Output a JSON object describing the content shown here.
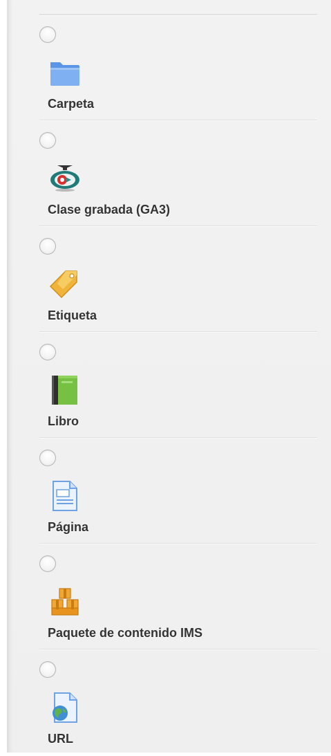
{
  "modules": [
    {
      "label": "Carpeta",
      "icon": "folder-icon"
    },
    {
      "label": "Clase grabada (GA3)",
      "icon": "recorded-class-icon"
    },
    {
      "label": "Etiqueta",
      "icon": "label-tag-icon"
    },
    {
      "label": "Libro",
      "icon": "book-icon"
    },
    {
      "label": "Página",
      "icon": "page-icon"
    },
    {
      "label": "Paquete de contenido IMS",
      "icon": "ims-package-icon"
    },
    {
      "label": "URL",
      "icon": "url-icon"
    }
  ],
  "colors": {
    "panel_bg": "#f2f2f2",
    "label_text": "#333333",
    "divider": "#e0e0e0"
  }
}
